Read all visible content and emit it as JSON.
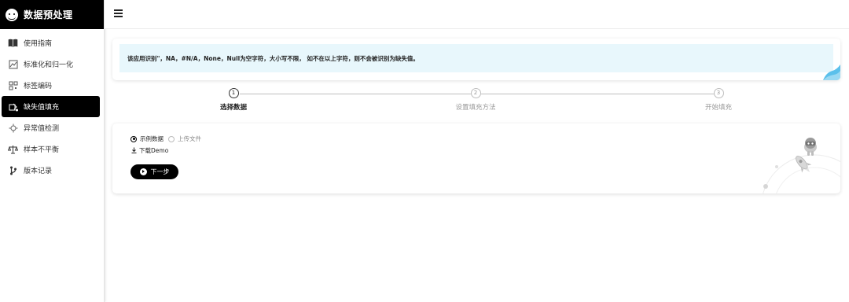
{
  "app": {
    "title": "数据预处理",
    "logo_icon": "robot-face-icon"
  },
  "topbar": {
    "menu_icon": "hamburger-menu-icon"
  },
  "sidebar": {
    "items": [
      {
        "label": "使用指南",
        "icon": "book-icon",
        "active": false
      },
      {
        "label": "标准化和归一化",
        "icon": "chart-image-icon",
        "active": false
      },
      {
        "label": "标签编码",
        "icon": "qr-code-icon",
        "active": false
      },
      {
        "label": "缺失值填充",
        "icon": "fill-icon",
        "active": true
      },
      {
        "label": "异常值检测",
        "icon": "detect-icon",
        "active": false
      },
      {
        "label": "样本不平衡",
        "icon": "balance-scale-icon",
        "active": false
      },
      {
        "label": "版本记录",
        "icon": "git-branch-icon",
        "active": false
      }
    ]
  },
  "notice": {
    "text": "该应用识别\"，NA，#N/A，None，Null为空字符，大小写不限， 如不在以上字符，则不会被识别为缺失值。"
  },
  "steps": [
    {
      "number": "1",
      "label": "选择数据",
      "active": true
    },
    {
      "number": "2",
      "label": "设置填充方法",
      "active": false
    },
    {
      "number": "3",
      "label": "开始填充",
      "active": false
    }
  ],
  "form": {
    "options": [
      {
        "label": "示例数据",
        "checked": true
      },
      {
        "label": "上传文件",
        "checked": false
      }
    ],
    "download_label": "下载Demo",
    "next_label": "下一步"
  },
  "colors": {
    "brand": "#000000",
    "notice_bg": "#e8f7fc",
    "accent": "#5bc0eb"
  }
}
